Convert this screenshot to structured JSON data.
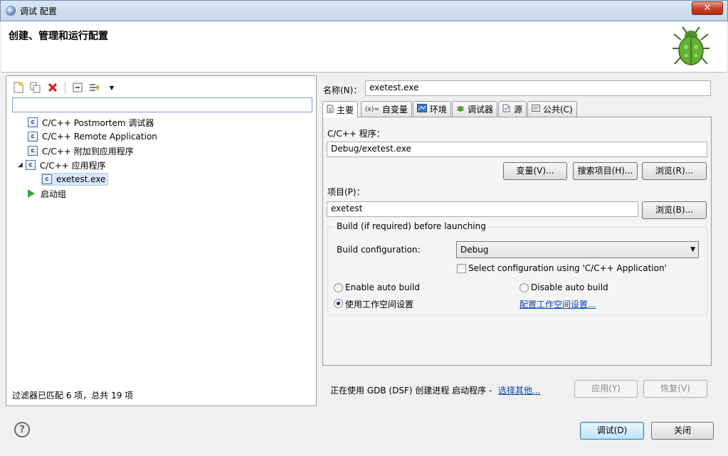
{
  "window": {
    "title": "调试 配置"
  },
  "header": {
    "title": "创建、管理和运行配置"
  },
  "left": {
    "tree": [
      {
        "label": "C/C++ Postmortem 调试器"
      },
      {
        "label": "C/C++ Remote Application"
      },
      {
        "label": "C/C++ 附加到应用程序"
      },
      {
        "label": "C/C++ 应用程序"
      },
      {
        "label": "exetest.exe"
      },
      {
        "label": "启动组"
      }
    ],
    "status": "过滤器已匹配 6 项，总共 19 项",
    "filter_value": ""
  },
  "right": {
    "name_label": "名称(N)：",
    "name_value": "exetest.exe",
    "tabs": [
      {
        "label": "主要"
      },
      {
        "label": "自变量"
      },
      {
        "label": "环境"
      },
      {
        "label": "调试器"
      },
      {
        "label": "源"
      },
      {
        "label": "公共(C)"
      }
    ],
    "tab_icons": {
      "args": "(x)="
    },
    "program_label": "C/C++ 程序：",
    "program_value": "Debug/exetest.exe",
    "btn_vars": "变量(V)...",
    "btn_search": "搜索项目(H)...",
    "btn_browse1": "浏览(R)...",
    "project_label": "项目(P)：",
    "project_value": "exetest",
    "btn_browse2": "浏览(B)...",
    "build_group": "Build (if required) before launching",
    "build_conf_label": "Build configuration:",
    "build_conf_value": "Debug",
    "select_conf_label": "Select configuration using 'C/C++ Application'",
    "enable_auto": "Enable auto build",
    "disable_auto": "Disable auto build",
    "use_workspace": "使用工作空间设置",
    "config_workspace_link": "配置工作空间设置...",
    "launcher_text": "正在使用 GDB (DSF) 创建进程 启动程序 -",
    "launcher_link": "选择其他...",
    "btn_apply": "应用(Y)",
    "btn_revert": "恢复(V)"
  },
  "footer": {
    "help_glyph": "?",
    "btn_debug": "调试(D)",
    "btn_close": "关闭"
  },
  "icons": {
    "close": "✕",
    "c_glyph": "c",
    "collapse": "◢",
    "dropdown": "▼"
  }
}
